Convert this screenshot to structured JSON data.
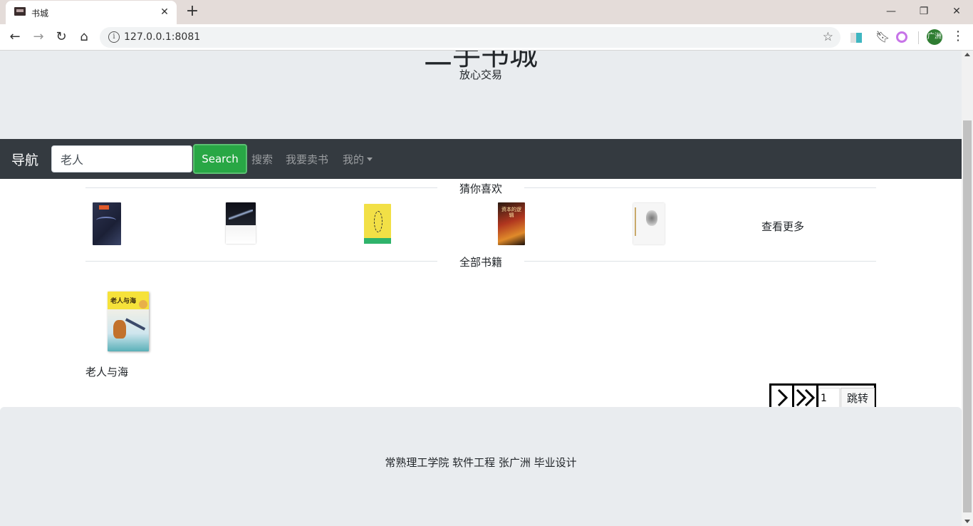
{
  "browser": {
    "tab_title": "书城",
    "url": "127.0.0.1:8081",
    "profile_initials": "广洲"
  },
  "header": {
    "title": "二手书城",
    "subtitle": "放心交易"
  },
  "navbar": {
    "brand": "导航",
    "search_value": "老人",
    "search_button": "Search",
    "links": [
      "搜索",
      "我要卖书",
      "我的"
    ]
  },
  "recommend": {
    "title": "猜你喜欢",
    "more": "查看更多",
    "book_cover_texts": [
      "资本的逻辑"
    ]
  },
  "books": {
    "title": "全部书籍",
    "items": [
      {
        "name": "老人与海",
        "cover_text": "老人与海"
      }
    ]
  },
  "pagination": {
    "page_value": "1",
    "jump_label": "跳转"
  },
  "footer": {
    "text": "常熟理工学院 软件工程 张广洲 毕业设计"
  }
}
